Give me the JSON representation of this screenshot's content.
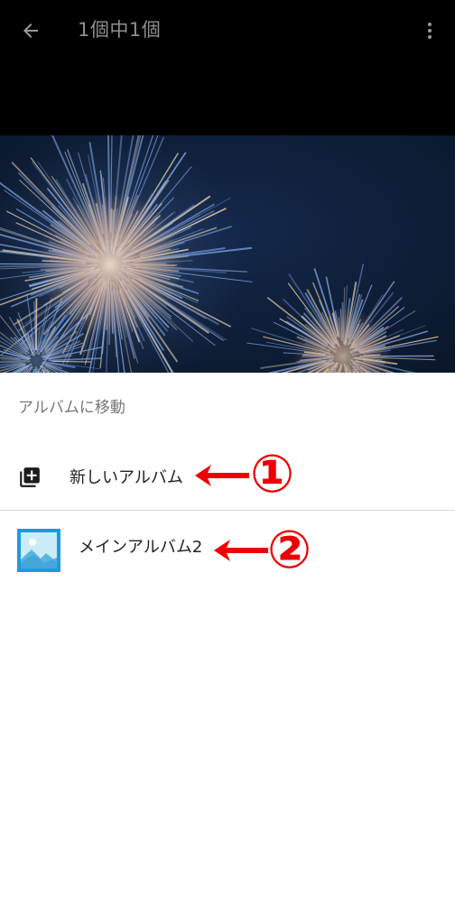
{
  "header": {
    "title": "1個中1個",
    "back_icon": "arrow-left-icon",
    "menu_icon": "more-vert-icon"
  },
  "photo": {
    "subject": "fireworks",
    "colors": {
      "sky": "#0d1b33",
      "burst_warm": "#f4d6b0",
      "burst_cool": "#7fa7e6"
    }
  },
  "sheet": {
    "title": "アルバムに移動",
    "items": [
      {
        "label": "新しいアルバム",
        "icon": "add-to-photos-icon"
      },
      {
        "label": "メインアルバム2",
        "icon": "album-thumbnail-icon"
      }
    ]
  },
  "annotations": [
    {
      "number": "①",
      "color": "#ee0000"
    },
    {
      "number": "②",
      "color": "#ee0000"
    }
  ]
}
